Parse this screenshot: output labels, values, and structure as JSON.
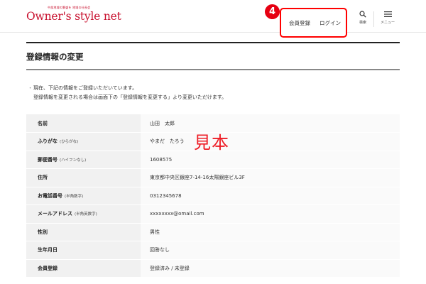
{
  "brand": {
    "tagline": "中部地域の繁盛を 地域の社長会",
    "name": "Owner's style net"
  },
  "nav": {
    "register_label": "会員登録",
    "login_label": "ログイン",
    "search_label": "検索",
    "menu_label": "メニュー"
  },
  "badge": {
    "number": "4",
    "color": "#e60012"
  },
  "page": {
    "title": "登録情報の変更",
    "notes": [
      "現在、下記の情報をご登録いただいています。",
      "登録情報を変更される場合は画面下の「登録情報を変更する」より変更いただけます。"
    ]
  },
  "watermark": "見本",
  "table": {
    "rows": [
      {
        "label": "名前",
        "sub": "",
        "value": "山田　太郎"
      },
      {
        "label": "ふりがな",
        "sub": "(ひらがな)",
        "value": "やまだ　たろう"
      },
      {
        "label": "郵便番号",
        "sub": "(ハイフンなし)",
        "value": "1608575"
      },
      {
        "label": "住所",
        "sub": "",
        "value": "東京都中央区銀座7-14-16太陽銀座ビル3F"
      },
      {
        "label": "お電話番号",
        "sub": "(半角数字)",
        "value": "0312345678"
      },
      {
        "label": "メールアドレス",
        "sub": "(半角英数字)",
        "value": "xxxxxxxx@omail.com"
      },
      {
        "label": "性別",
        "sub": "",
        "value": "男性"
      },
      {
        "label": "生年月日",
        "sub": "",
        "value": "回答なし"
      },
      {
        "label": "会員登録",
        "sub": "",
        "value": "登録済み / 未登録"
      }
    ]
  },
  "colors": {
    "brand_red": "#c8102e",
    "highlight_red": "#ff0000",
    "label_bg": "#f1f1f1",
    "value_bg": "#fafafa"
  }
}
